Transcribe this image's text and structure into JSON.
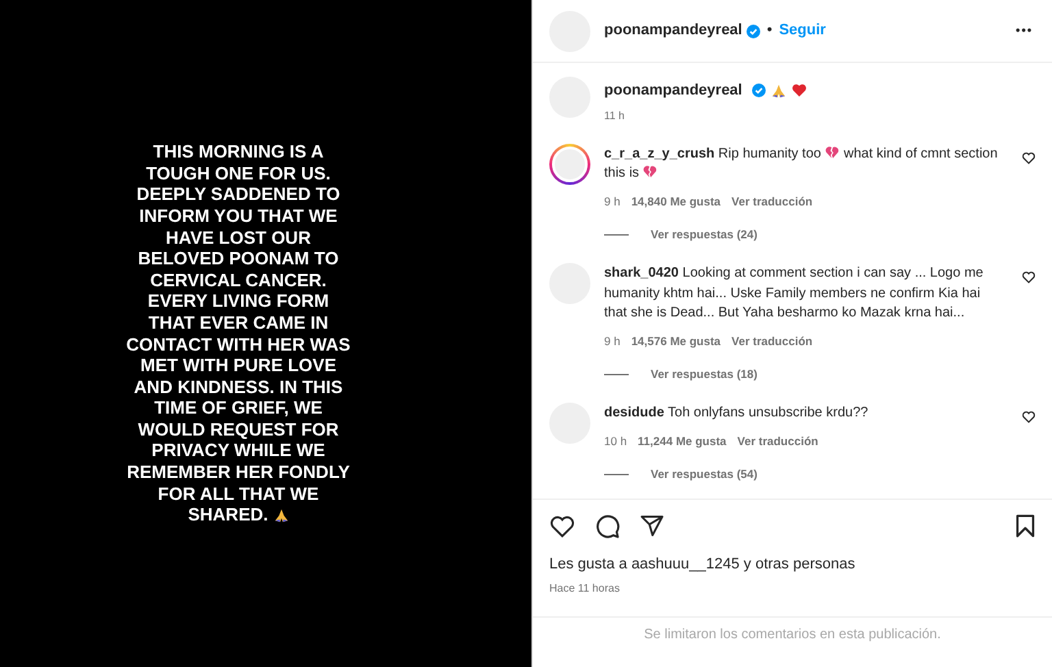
{
  "post": {
    "text_lines": [
      "THIS MORNING IS A",
      "TOUGH ONE FOR US.",
      "DEEPLY SADDENED TO",
      "INFORM YOU THAT WE",
      "HAVE LOST OUR",
      "BELOVED POONAM TO",
      "CERVICAL CANCER.",
      "EVERY LIVING FORM",
      "THAT EVER CAME IN",
      "CONTACT WITH HER WAS",
      "MET WITH PURE LOVE",
      "AND KINDNESS. IN THIS",
      "TIME OF GRIEF, WE",
      "WOULD REQUEST FOR",
      "PRIVACY WHILE WE",
      "REMEMBER HER FONDLY",
      "FOR ALL THAT WE",
      "SHARED."
    ]
  },
  "header": {
    "username": "poonampandeyreal",
    "verified": true,
    "separator": "•",
    "follow": "Seguir",
    "more": "•••"
  },
  "caption": {
    "username": "poonampandeyreal",
    "verified": true,
    "time": "11 h"
  },
  "comments": [
    {
      "username": "c_r_a_z_y_crush",
      "story_ring": true,
      "parts": [
        {
          "kind": "text",
          "text": "Rip humanity too "
        },
        {
          "kind": "broken_heart"
        },
        {
          "kind": "text",
          "text": " what kind of cmnt section this is "
        },
        {
          "kind": "broken_heart"
        }
      ],
      "time": "9 h",
      "likes": "14,840 Me gusta",
      "translate": "Ver traducción",
      "replies": "Ver respuestas (24)"
    },
    {
      "username": "shark_0420",
      "story_ring": false,
      "parts": [
        {
          "kind": "text",
          "text": "Looking at comment section i can say ... Logo me humanity khtm hai... Uske Family members ne confirm Kia hai that she is Dead... But Yaha besharmo ko Mazak krna hai..."
        }
      ],
      "time": "9 h",
      "likes": "14,576 Me gusta",
      "translate": "Ver traducción",
      "replies": "Ver respuestas (18)"
    },
    {
      "username": "desidude",
      "story_ring": false,
      "parts": [
        {
          "kind": "text",
          "text": "Toh onlyfans unsubscribe krdu??"
        }
      ],
      "time": "10 h",
      "likes": "11,244 Me gusta",
      "translate": "Ver traducción",
      "replies": "Ver respuestas (54)"
    }
  ],
  "likes_line": {
    "prefix": "Les gusta a ",
    "user": "aashuuu__1245",
    "suffix": " y otras personas"
  },
  "posted": "Hace 11 horas",
  "comments_notice": "Se limitaron los comentarios en esta publicación."
}
